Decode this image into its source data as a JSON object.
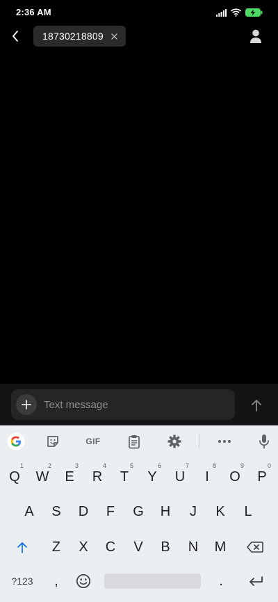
{
  "status_bar": {
    "time": "2:36 AM",
    "battery_color": "#4cd964"
  },
  "header": {
    "recipient": "18730218809",
    "icons": [
      "back-arrow-icon",
      "close-icon",
      "contact-person-icon"
    ]
  },
  "compose": {
    "placeholder": "Text message",
    "attach_icon": "plus-icon",
    "send_icon": "arrow-up-icon"
  },
  "keyboard": {
    "toolbar": {
      "gif_label": "GIF",
      "items": [
        "google-g-icon",
        "sticker-icon",
        "gif-icon",
        "clipboard-icon",
        "settings-gear-icon",
        "more-dots-icon",
        "microphone-icon"
      ]
    },
    "row1": [
      {
        "label": "Q",
        "hint": "1"
      },
      {
        "label": "W",
        "hint": "2"
      },
      {
        "label": "E",
        "hint": "3"
      },
      {
        "label": "R",
        "hint": "4"
      },
      {
        "label": "T",
        "hint": "5"
      },
      {
        "label": "Y",
        "hint": "6"
      },
      {
        "label": "U",
        "hint": "7"
      },
      {
        "label": "I",
        "hint": "8"
      },
      {
        "label": "O",
        "hint": "9"
      },
      {
        "label": "P",
        "hint": "0"
      }
    ],
    "row2": [
      "A",
      "S",
      "D",
      "F",
      "G",
      "H",
      "J",
      "K",
      "L"
    ],
    "row3": [
      "Z",
      "X",
      "C",
      "V",
      "B",
      "N",
      "M"
    ],
    "row4": {
      "symbols": "?123",
      "comma": ",",
      "period": "."
    },
    "accent_color": "#1a73e8"
  }
}
